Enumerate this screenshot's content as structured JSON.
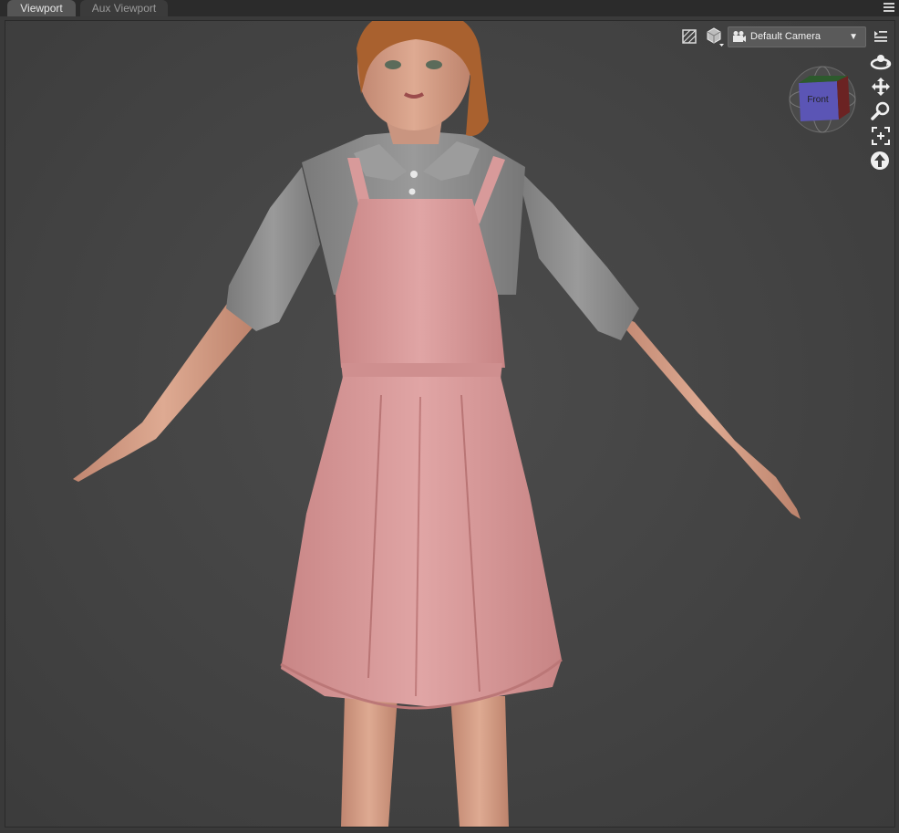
{
  "tabs": [
    {
      "label": "Viewport",
      "active": true
    },
    {
      "label": "Aux Viewport",
      "active": false
    }
  ],
  "viewport": {
    "camera_select": {
      "value": "Default Camera"
    },
    "view_cube": {
      "face_label": "Front"
    },
    "tools": [
      "orbit-icon",
      "pan-icon",
      "zoom-icon",
      "frame-icon",
      "up-arrow-icon"
    ],
    "toolbar_icons": [
      "draw-style-icon",
      "perspective-cube-icon",
      "camera-icon",
      "viewport-options-icon"
    ]
  },
  "colors": {
    "background": "#434343",
    "dress": "#d99999",
    "shirt": "#8a8a8a",
    "skin": "#d9a088",
    "hair": "#a9612f"
  }
}
